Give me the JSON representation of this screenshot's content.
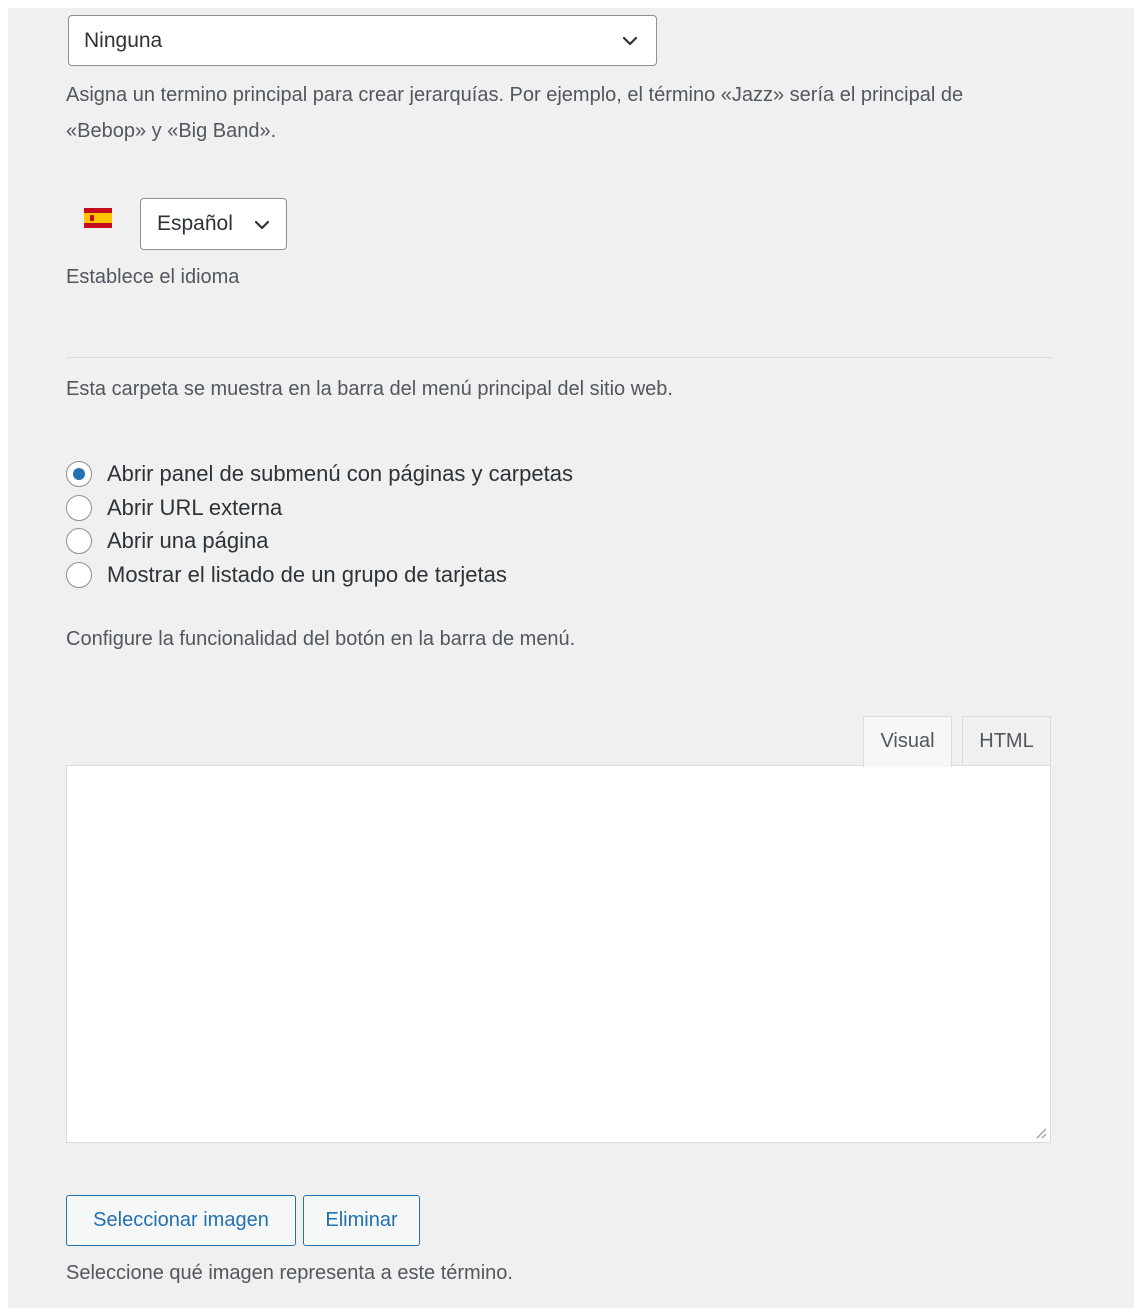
{
  "parent_term": {
    "selected": "Ninguna",
    "description": "Asigna un termino principal para crear jerarquías. Por ejemplo, el término «Jazz» sería el principal de «Bebop» y «Big Band»."
  },
  "language": {
    "flag_icon": "spain-flag-icon",
    "selected": "Español",
    "description": "Establece el idioma"
  },
  "menu": {
    "info": "Esta carpeta se muestra en la barra del menú principal del sitio web.",
    "options": [
      {
        "label": "Abrir panel de submenú con páginas y carpetas",
        "checked": true
      },
      {
        "label": "Abrir URL externa",
        "checked": false
      },
      {
        "label": "Abrir una página",
        "checked": false
      },
      {
        "label": "Mostrar el listado de un grupo de tarjetas",
        "checked": false
      }
    ],
    "description": "Configure la funcionalidad del botón en la barra de menú."
  },
  "editor": {
    "tab_visual": "Visual",
    "tab_html": "HTML",
    "active_tab": "Visual",
    "content": ""
  },
  "image": {
    "select_label": "Seleccionar imagen",
    "remove_label": "Eliminar",
    "description": "Seleccione qué imagen representa a este término."
  },
  "colors": {
    "panel_bg": "#f0f0f1",
    "accent": "#2271b1",
    "border": "#8c8f94"
  }
}
